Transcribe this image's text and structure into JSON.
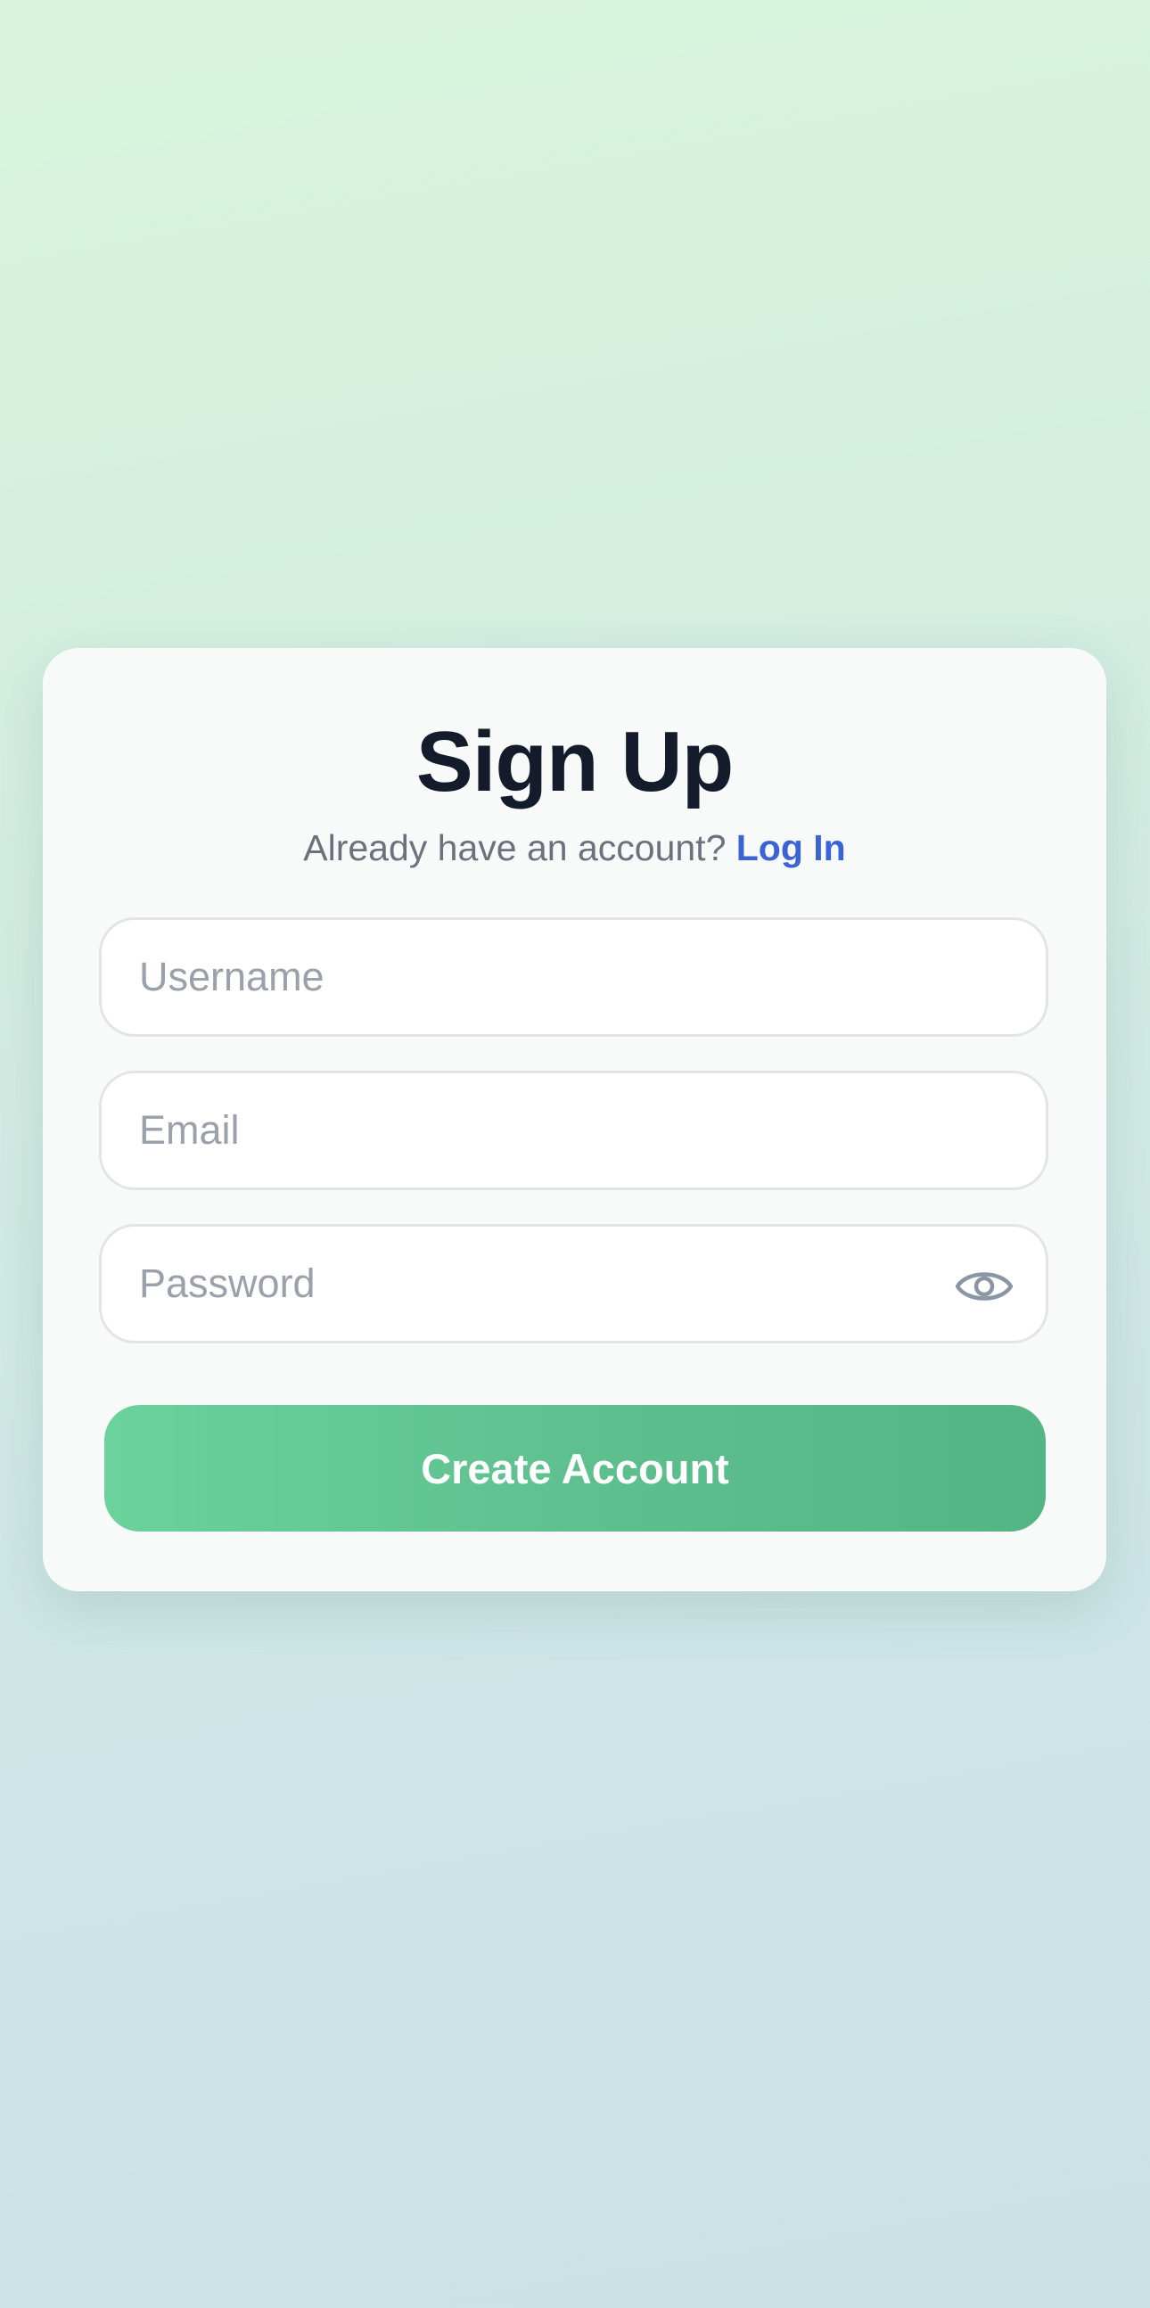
{
  "signup": {
    "title": "Sign Up",
    "account_prompt": "Already have an account?",
    "login_link": "Log In",
    "username": {
      "placeholder": "Username",
      "value": ""
    },
    "email": {
      "placeholder": "Email",
      "value": ""
    },
    "password": {
      "placeholder": "Password",
      "value": ""
    },
    "password_toggle_icon": "eye-icon",
    "submit_label": "Create Account"
  },
  "colors": {
    "accent": "#5ec08f",
    "link": "#3a63d6",
    "title": "#141c2c"
  }
}
